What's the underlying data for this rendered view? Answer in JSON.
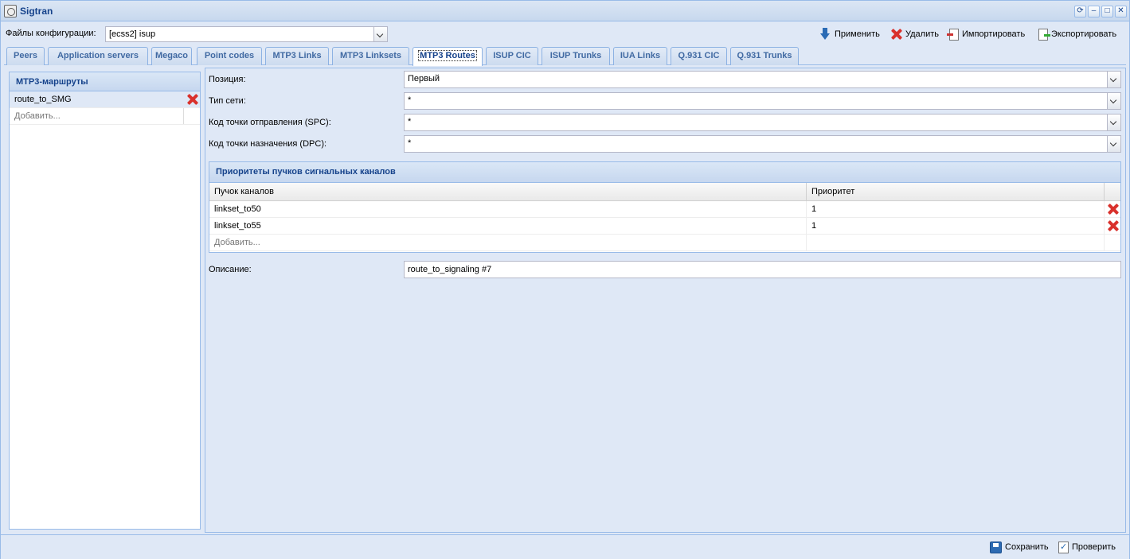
{
  "window": {
    "title": "Sigtran"
  },
  "config": {
    "label": "Файлы конфигурации:",
    "selected": "[ecss2] isup"
  },
  "actions": {
    "apply": "Применить",
    "delete": "Удалить",
    "import": "Импортировать",
    "export": "Экспортировать"
  },
  "tabs": [
    {
      "label": "Peers"
    },
    {
      "label": "Application servers"
    },
    {
      "label": "Megaco"
    },
    {
      "label": "Point codes"
    },
    {
      "label": "MTP3 Links"
    },
    {
      "label": "MTP3 Linksets"
    },
    {
      "label": "MTP3 Routes",
      "active": true
    },
    {
      "label": "ISUP CIC"
    },
    {
      "label": "ISUP Trunks"
    },
    {
      "label": "IUA Links"
    },
    {
      "label": "Q.931 CIC"
    },
    {
      "label": "Q.931 Trunks"
    }
  ],
  "routes_panel": {
    "title": "МТР3-маршруты",
    "items": [
      {
        "name": "route_to_SMG"
      }
    ],
    "add_placeholder": "Добавить..."
  },
  "form": {
    "position_label": "Позиция:",
    "position_value": "Первый",
    "network_label": "Тип сети:",
    "network_value": "*",
    "spc_label": "Код точки отправления (SPC):",
    "spc_value": "*",
    "dpc_label": "Код точки назначения (DPC):",
    "dpc_value": "*",
    "description_label": "Описание:",
    "description_value": "route_to_signaling #7"
  },
  "priorities": {
    "title": "Приоритеты пучков сигнальных каналов",
    "col_linkset": "Пучок каналов",
    "col_priority": "Приоритет",
    "rows": [
      {
        "linkset": "linkset_to50",
        "priority": "1"
      },
      {
        "linkset": "linkset_to55",
        "priority": "1"
      }
    ],
    "add_placeholder": "Добавить..."
  },
  "footer": {
    "save": "Сохранить",
    "check": "Проверить"
  }
}
